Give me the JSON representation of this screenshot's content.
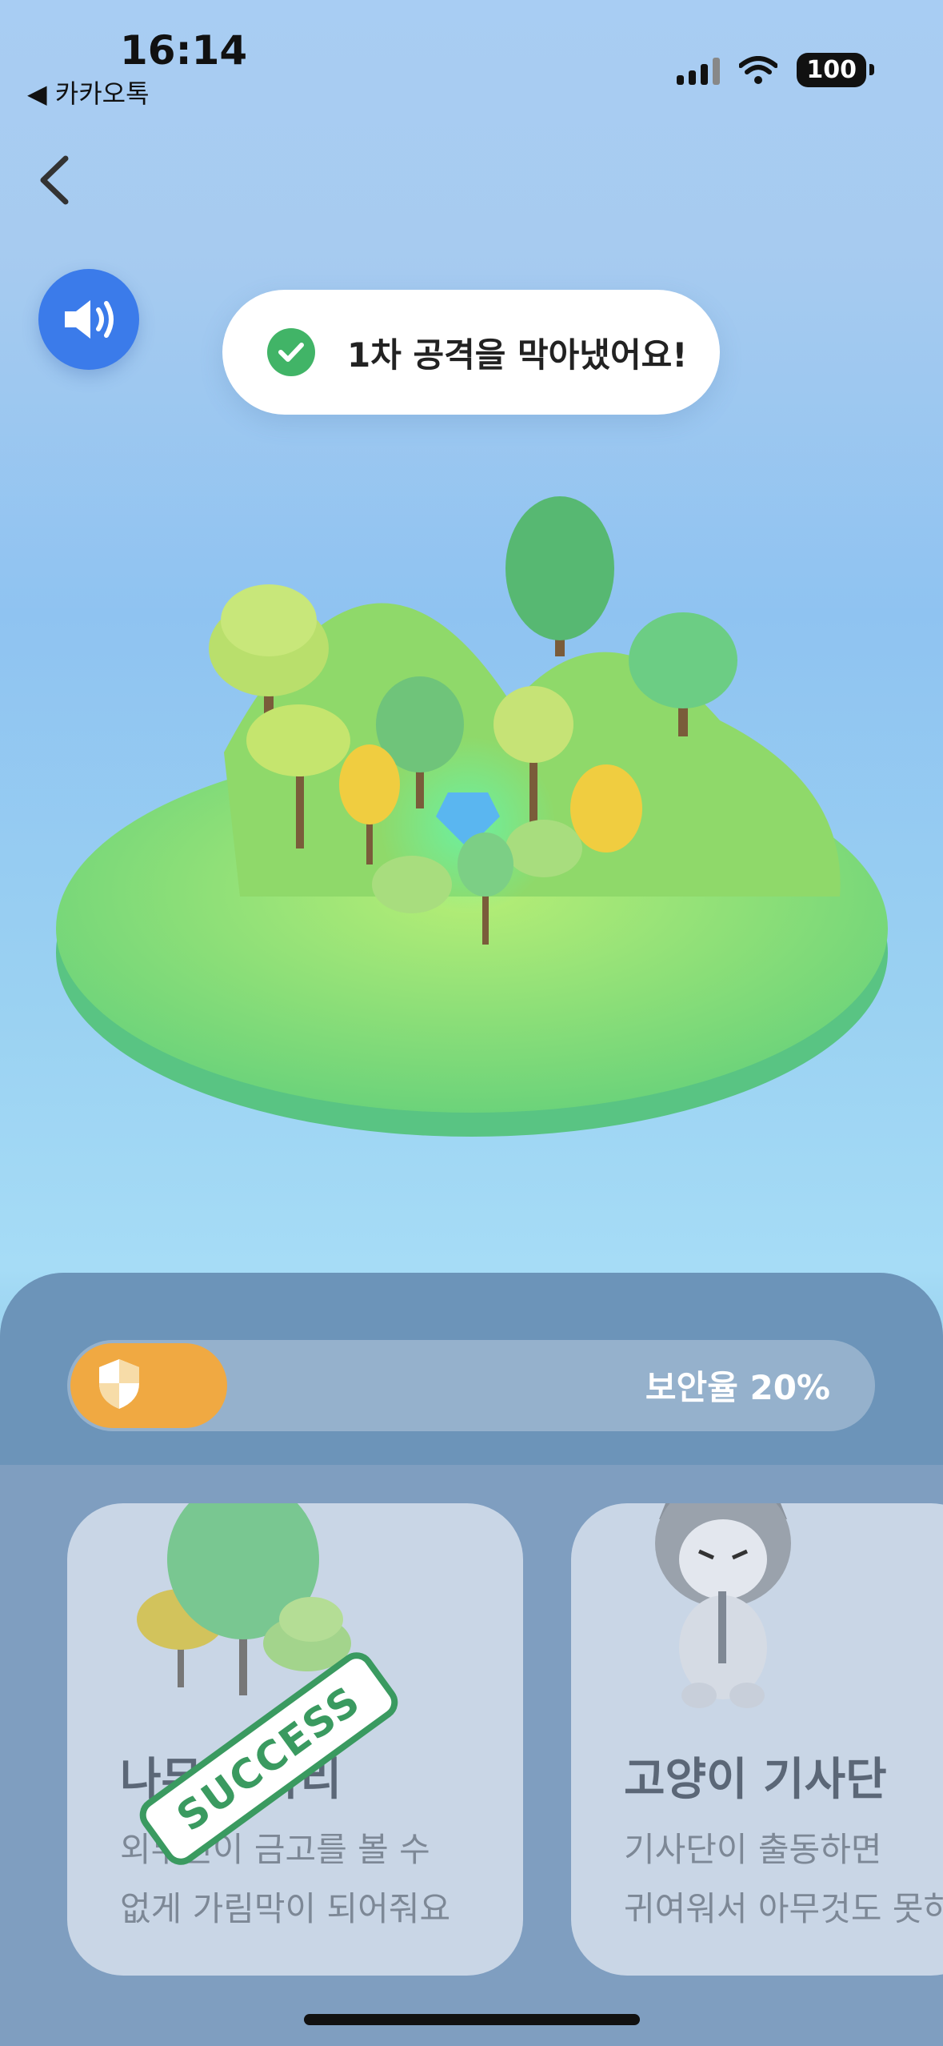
{
  "status_bar": {
    "time": "16:14",
    "back_app": "◀ 카카오톡",
    "battery": "100"
  },
  "toast": {
    "message": "1차 공격을 막아냈어요!"
  },
  "progress": {
    "label": "보안율 20%",
    "value_percent": 20,
    "fill_color": "#f0a942"
  },
  "cards": [
    {
      "title": "나무 울타리",
      "desc_line1": "외부인이 금고를 볼 수",
      "desc_line2": "없게 가림막이 되어줘요",
      "stamp": "SUCCESS"
    },
    {
      "title": "고양이 기사단",
      "desc_line1": "기사단이 출동하면",
      "desc_line2": "귀여워서 아무것도 못하"
    }
  ],
  "icons": [
    "back-chevron-icon",
    "speaker-icon",
    "check-icon",
    "shield-icon"
  ],
  "colors": {
    "accent_blue": "#3b7bea",
    "success_green": "#41b467",
    "progress_orange": "#f0a942"
  }
}
